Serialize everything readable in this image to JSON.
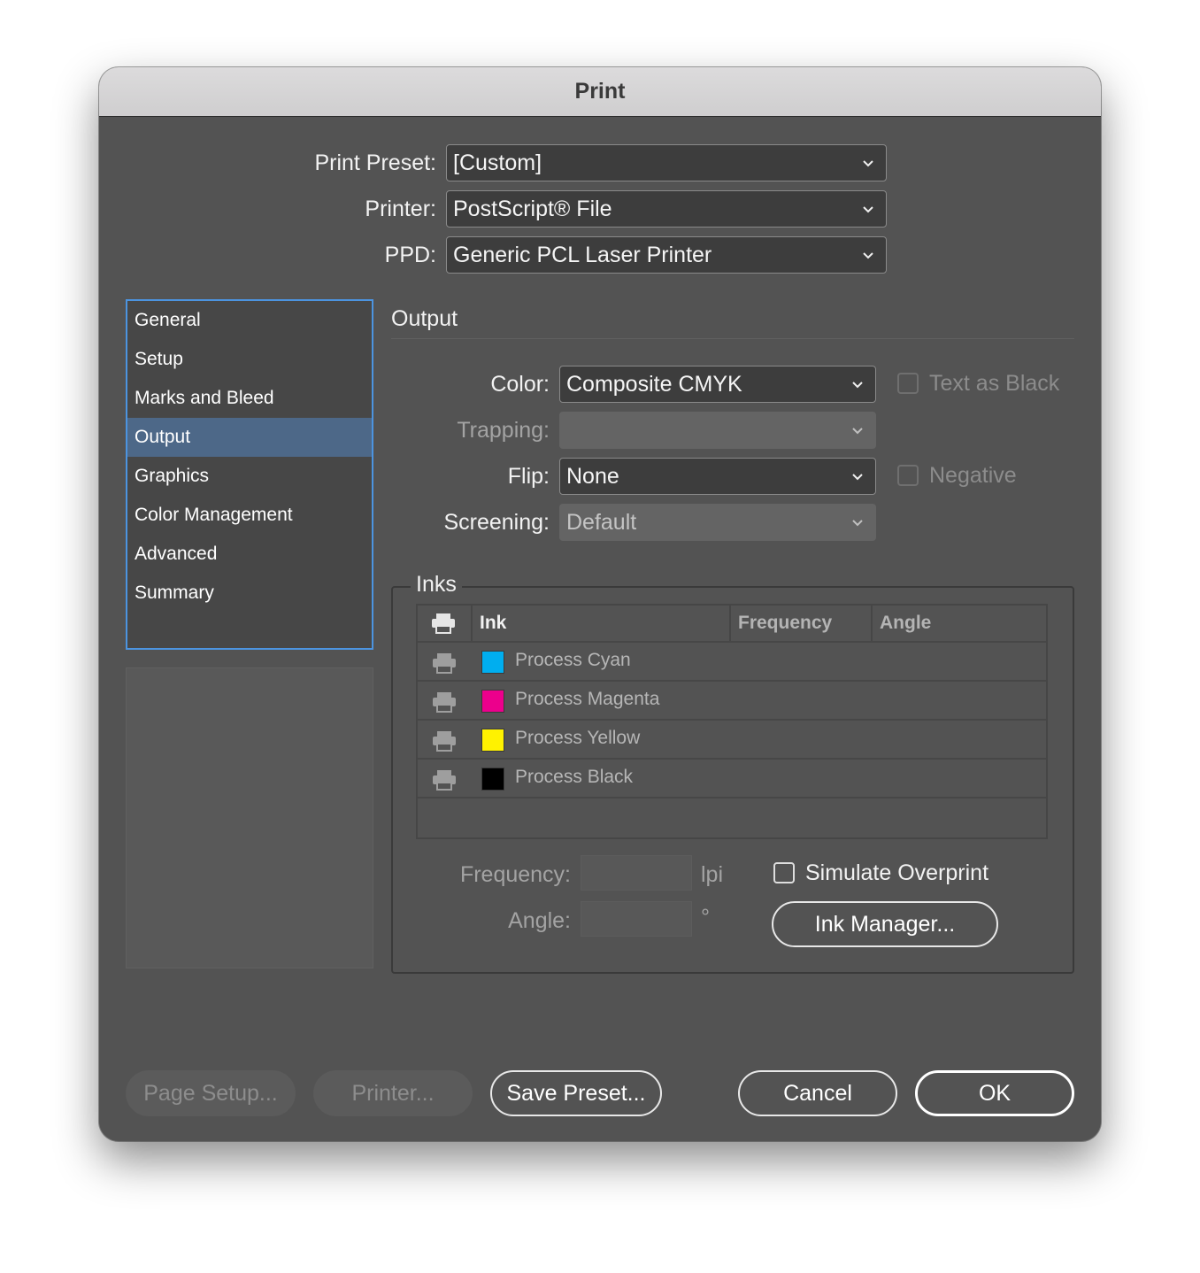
{
  "window": {
    "title": "Print"
  },
  "top": {
    "preset_label": "Print Preset:",
    "preset_value": "[Custom]",
    "printer_label": "Printer:",
    "printer_value": "PostScript® File",
    "ppd_label": "PPD:",
    "ppd_value": "Generic PCL Laser Printer"
  },
  "sidebar": {
    "items": [
      {
        "label": "General"
      },
      {
        "label": "Setup"
      },
      {
        "label": "Marks and Bleed"
      },
      {
        "label": "Output"
      },
      {
        "label": "Graphics"
      },
      {
        "label": "Color Management"
      },
      {
        "label": "Advanced"
      },
      {
        "label": "Summary"
      }
    ],
    "selected": "Output"
  },
  "output": {
    "title": "Output",
    "color_label": "Color:",
    "color_value": "Composite CMYK",
    "text_as_black": "Text as Black",
    "trapping_label": "Trapping:",
    "trapping_value": "",
    "flip_label": "Flip:",
    "flip_value": "None",
    "negative": "Negative",
    "screening_label": "Screening:",
    "screening_value": "Default"
  },
  "inks": {
    "title": "Inks",
    "columns": {
      "ink": "Ink",
      "frequency": "Frequency",
      "angle": "Angle"
    },
    "rows": [
      {
        "name": "Process Cyan",
        "color": "#00aeef"
      },
      {
        "name": "Process Magenta",
        "color": "#ec008c"
      },
      {
        "name": "Process Yellow",
        "color": "#fff200"
      },
      {
        "name": "Process Black",
        "color": "#000000"
      }
    ],
    "frequency_label": "Frequency:",
    "frequency_unit": "lpi",
    "angle_label": "Angle:",
    "angle_unit": "°",
    "simulate_overprint": "Simulate Overprint",
    "ink_manager": "Ink Manager..."
  },
  "buttons": {
    "page_setup": "Page Setup...",
    "printer": "Printer...",
    "save_preset": "Save Preset...",
    "cancel": "Cancel",
    "ok": "OK"
  }
}
